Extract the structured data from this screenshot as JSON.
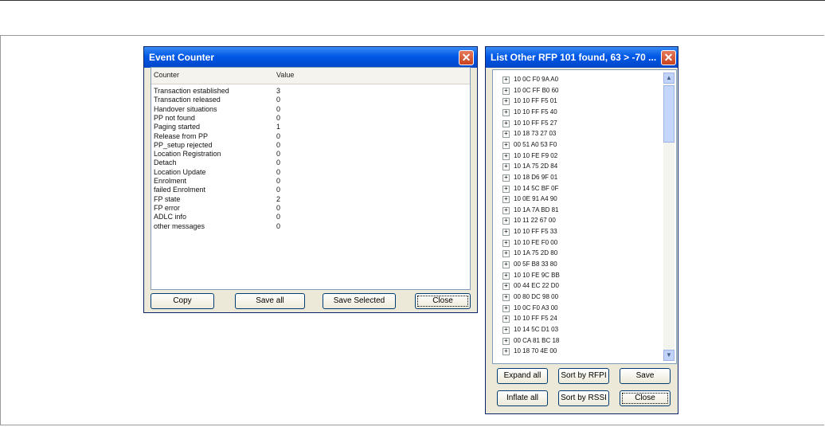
{
  "event_counter": {
    "title": "Event Counter",
    "close_glyph": "✕",
    "columns": {
      "counter": "Counter",
      "value": "Value"
    },
    "rows": [
      {
        "name": "Transaction established",
        "value": "3"
      },
      {
        "name": "Transaction released",
        "value": "0"
      },
      {
        "name": "Handover situations",
        "value": "0"
      },
      {
        "name": "PP not found",
        "value": "0"
      },
      {
        "name": "Paging started",
        "value": "1"
      },
      {
        "name": "Release from PP",
        "value": "0"
      },
      {
        "name": "PP_setup rejected",
        "value": "0"
      },
      {
        "name": "Location Registration",
        "value": "0"
      },
      {
        "name": "Detach",
        "value": "0"
      },
      {
        "name": "Location Update",
        "value": "0"
      },
      {
        "name": "Enrolment",
        "value": "0"
      },
      {
        "name": "failed Enrolment",
        "value": "0"
      },
      {
        "name": "FP state",
        "value": "2"
      },
      {
        "name": "FP error",
        "value": "0"
      },
      {
        "name": "ADLC info",
        "value": "0"
      },
      {
        "name": "other messages",
        "value": "0"
      }
    ],
    "buttons": {
      "copy": "Copy",
      "save_all": "Save all",
      "save_selected": "Save Selected",
      "close": "Close"
    }
  },
  "rfp_list": {
    "title": "List Other RFP  101 found, 63 > -70 ...",
    "close_glyph": "✕",
    "expander": "+",
    "items": [
      "10 0C F0 9A A0",
      "10 0C FF B0 60",
      "10 10 FF F5 01",
      "10 10 FF F5 40",
      "10 10 FF F5 27",
      "10 18 73 27 03",
      "00 51 A0 53 F0",
      "10 10 FE F9 02",
      "10 1A 75 2D 84",
      "10 18 D6 9F 01",
      "10 14 5C BF 0F",
      "10 0E 91 A4 90",
      "10 1A 7A BD 81",
      "10 11 22 67 00",
      "10 10 FF F5 33",
      "10 10 FE F0 00",
      "10 1A 75 2D 80",
      "00 5F B8 33 80",
      "10 10 FE 9C BB",
      "00 44 EC 22 D0",
      "00 80 DC 98 00",
      "10 0C F0 A3 00",
      "10 10 FF F5 24",
      "10 14 5C D1 03",
      "00 CA 81 BC 18",
      "10 18 70 4E 00"
    ],
    "scroll_up": "▲",
    "scroll_down": "▼",
    "buttons": {
      "expand_all": "Expand all",
      "sort_rfpi": "Sort by RFPI",
      "save": "Save",
      "inflate_all": "Inflate all",
      "sort_rssi": "Sort by RSSI",
      "close": "Close"
    }
  }
}
